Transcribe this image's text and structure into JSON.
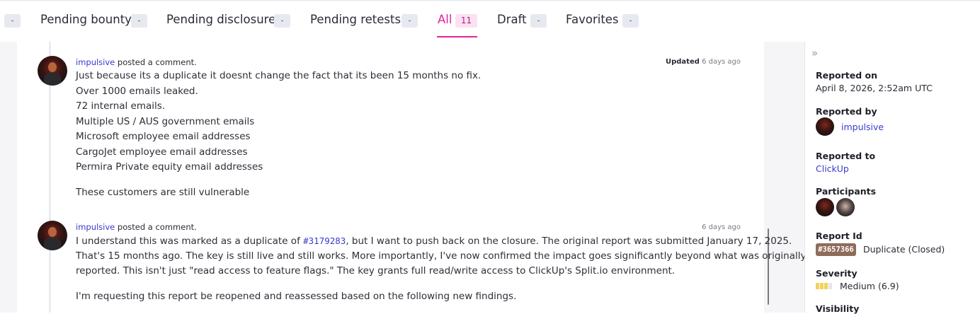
{
  "tabs": [
    {
      "label": "",
      "count": "-"
    },
    {
      "label": "Pending bounty",
      "count": "-"
    },
    {
      "label": "Pending disclosure",
      "count": "-"
    },
    {
      "label": "Pending retests",
      "count": "-"
    },
    {
      "label": "All",
      "count": "11",
      "active": true
    },
    {
      "label": "Draft",
      "count": "-"
    },
    {
      "label": "Favorites",
      "count": "-"
    }
  ],
  "comments": [
    {
      "author": "impulsive",
      "action": "posted a comment.",
      "timestamp_prefix": "Updated",
      "timestamp": "6 days ago",
      "lines": [
        "Just because its a duplicate it doesnt change the fact that its been 15 months no fix.",
        "Over 1000 emails leaked.",
        "72 internal emails.",
        "Multiple US / AUS government emails",
        "Microsoft employee email addresses",
        "CargoJet employee email addresses",
        "Permira Private equity email addresses",
        "These customers are still vulnerable"
      ]
    },
    {
      "author": "impulsive",
      "action": "posted a comment.",
      "timestamp": "6 days ago",
      "line1_before": "I understand this was marked as a duplicate of ",
      "line1_ref": "#3179283",
      "line1_after": ", but I want to push back on the closure. The original report was submitted January 17, 2025.",
      "lines": [
        "That's 15 months ago. The key is still live and still works. More importantly, I've now confirmed the impact goes significantly beyond what was originally",
        "reported. This isn't just \"read access to feature flags.\" The key grants full read/write access to ClickUp's Split.io environment.",
        "I'm requesting this report be reopened and reassessed based on the following new findings."
      ]
    }
  ],
  "sidebar": {
    "collapse_icon": "»",
    "reported_on_label": "Reported on",
    "reported_on": "April 8, 2026, 2:52am UTC",
    "reported_by_label": "Reported by",
    "reported_by": "impulsive",
    "reported_to_label": "Reported to",
    "reported_to": "ClickUp",
    "participants_label": "Participants",
    "report_id_label": "Report Id",
    "report_id": "#3657366",
    "report_status": "Duplicate (Closed)",
    "severity_label": "Severity",
    "severity": "Medium (6.9)",
    "severity_level": 0.69,
    "visibility_label": "Visibility"
  },
  "colors": {
    "accent": "#e3249b",
    "link": "#3a3ad0",
    "severity_fill": "#f2d15c",
    "severity_empty": "#e6e6ea",
    "report_id_chip": "#8e6c5a"
  }
}
